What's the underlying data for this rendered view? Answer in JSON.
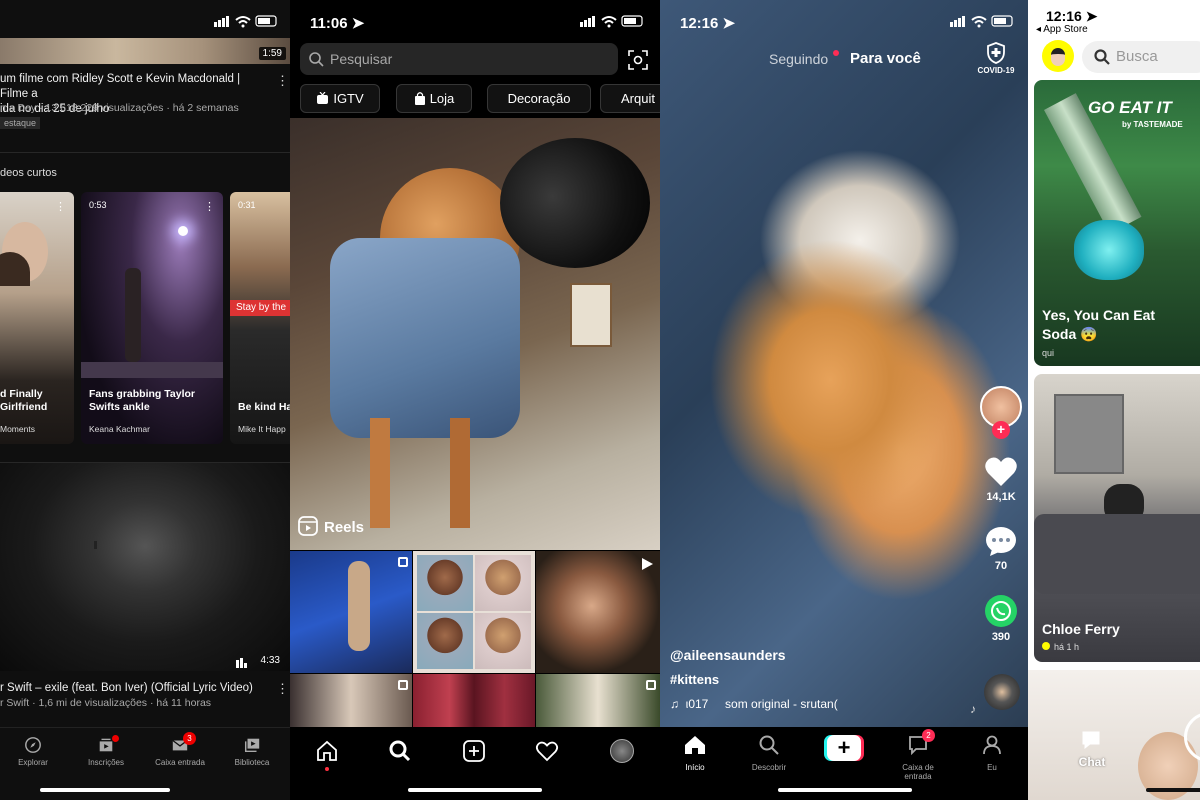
{
  "youtube": {
    "top_video": {
      "duration": "1:59",
      "title": "um filme com Ridley Scott e Kevin Macdonald | Filme a\nida no dia 25 de julho",
      "meta": "n a Day · 13.618.229 visualizações · há 2 semanas",
      "badge": "estaque"
    },
    "shorts_header": "deos curtos",
    "shorts": [
      {
        "title": "d Finally\nGirlfriend",
        "channel": "Moments",
        "duration": ""
      },
      {
        "title": "Fans grabbing Taylor\nSwifts ankle",
        "channel": "Keana Kachmar",
        "duration": "0:53"
      },
      {
        "title": "Be kind Ha",
        "channel": "Mike It Happ",
        "duration": "0:31",
        "overlay": "Stay by the"
      }
    ],
    "video": {
      "duration": "4:33",
      "title": "r Swift – exile (feat. Bon Iver) (Official Lyric Video)",
      "meta": "r Swift · 1,6 mi de visualizações · há 11 horas"
    },
    "nav": [
      {
        "label": "Explorar",
        "icon": "compass-icon"
      },
      {
        "label": "Inscrições",
        "icon": "subscriptions-icon"
      },
      {
        "label": "Caixa entrada",
        "icon": "inbox-icon",
        "badge": "3"
      },
      {
        "label": "Biblioteca",
        "icon": "library-icon"
      }
    ]
  },
  "instagram": {
    "time": "11:06",
    "search_placeholder": "Pesquisar",
    "chips": [
      "IGTV",
      "Loja",
      "Decoração",
      "Arquit"
    ],
    "reels_label": "Reels"
  },
  "tiktok": {
    "time": "12:16",
    "tab_following": "Seguindo",
    "tab_foryou": "Para você",
    "covid_label": "COVID-19",
    "likes": "14,1K",
    "comments": "70",
    "shares": "390",
    "username": "@aileensaunders",
    "hashtag": "#kittens",
    "sound": "♫  ι017     som original - srutan(",
    "nav": [
      {
        "label": "Início"
      },
      {
        "label": "Descobrir"
      },
      {
        "label": ""
      },
      {
        "label": "Caixa de entrada",
        "badge": "2"
      },
      {
        "label": "Eu"
      }
    ]
  },
  "snapchat": {
    "time": "12:16",
    "back_label": "◂ App Store",
    "search_placeholder": "Busca",
    "cards": [
      {
        "logo": "GO EAT IT",
        "logo_sub": "by TASTEMADE",
        "title": "Yes, You Can Eat\nSoda 😨",
        "sub": "qui"
      },
      {
        "title": "Chloe Ferry",
        "sub": "há 1 h"
      }
    ],
    "chat_label": "Chat"
  }
}
